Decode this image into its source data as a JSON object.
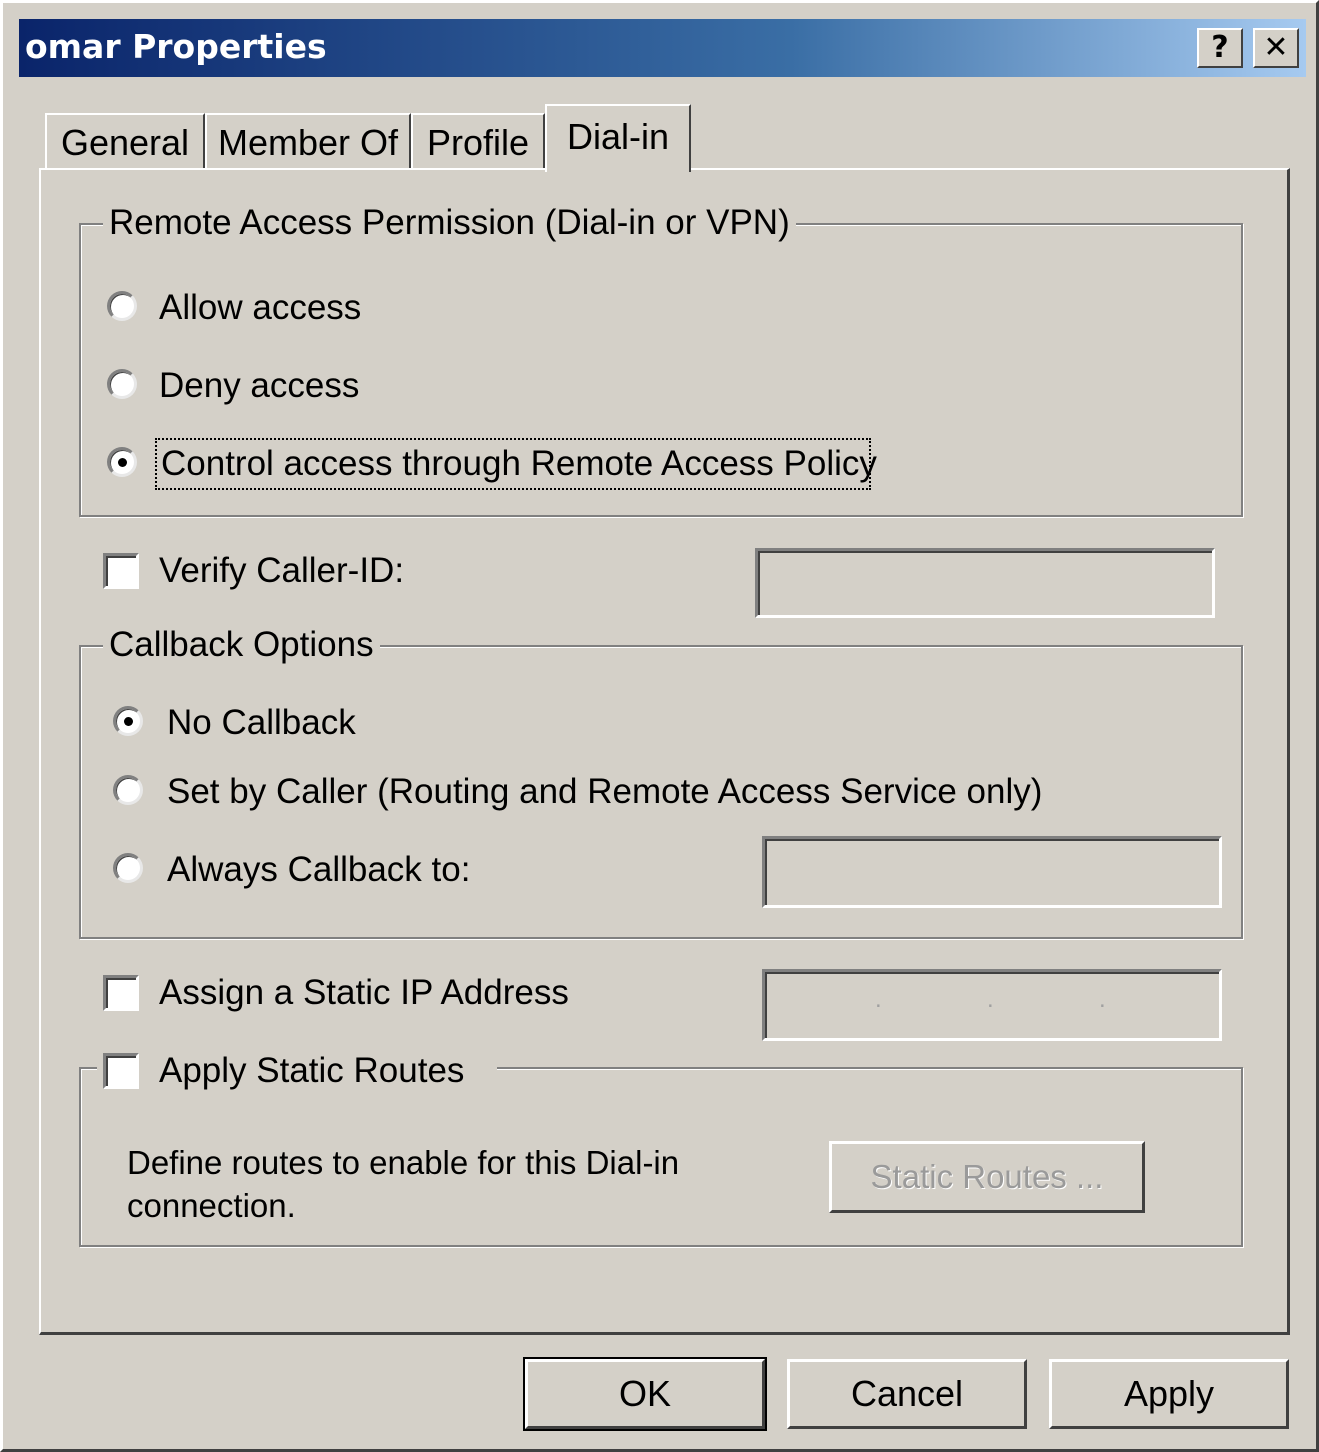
{
  "window": {
    "title": "omar Properties",
    "help_button": "?",
    "close_button": "✕"
  },
  "tabs": [
    {
      "label": "General"
    },
    {
      "label": "Member Of"
    },
    {
      "label": "Profile"
    },
    {
      "label": "Dial-in",
      "active": true
    }
  ],
  "remote_access": {
    "legend": "Remote Access Permission (Dial-in or VPN)",
    "options": [
      {
        "label": "Allow access",
        "selected": false
      },
      {
        "label": "Deny access",
        "selected": false
      },
      {
        "label": "Control access through Remote Access Policy",
        "selected": true
      }
    ]
  },
  "verify_caller_id": {
    "label": "Verify Caller-ID:",
    "checked": false,
    "value": ""
  },
  "callback": {
    "legend": "Callback Options",
    "options": [
      {
        "label": "No Callback",
        "selected": true
      },
      {
        "label": "Set by Caller (Routing and Remote Access Service only)",
        "selected": false
      },
      {
        "label": "Always Callback to:",
        "selected": false
      }
    ],
    "number_value": ""
  },
  "static_ip": {
    "label": "Assign a Static IP Address",
    "checked": false,
    "separators": [
      ".",
      ".",
      "."
    ]
  },
  "static_routes": {
    "label": "Apply Static Routes",
    "checked": false,
    "description_line1": "Define routes to enable for this Dial-in",
    "description_line2": "connection.",
    "button_label": "Static Routes ..."
  },
  "footer": {
    "ok_label": "OK",
    "cancel_label": "Cancel",
    "apply_label": "Apply"
  }
}
